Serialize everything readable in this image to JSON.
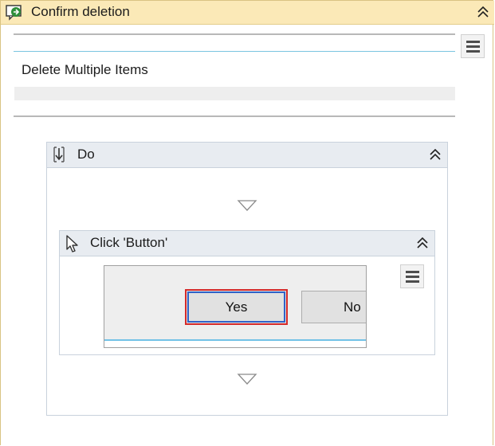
{
  "activity": {
    "title": "Confirm deletion",
    "icon": "message-box-icon",
    "collapse_icon": "chevron-double-up-icon",
    "menu_icon": "hamburger-menu-icon"
  },
  "message_text": "Delete Multiple Items",
  "do_sequence": {
    "title": "Do",
    "icon": "sequence-icon",
    "collapse_icon": "chevron-double-up-icon",
    "drop_icon": "drop-arrow-icon"
  },
  "click_activity": {
    "title": "Click 'Button'",
    "icon": "pointer-cursor-icon",
    "collapse_icon": "chevron-double-up-icon",
    "menu_icon": "hamburger-menu-icon",
    "preview": {
      "yes_label": "Yes",
      "no_label": "No"
    }
  },
  "colors": {
    "title_bar": "#fbe9b7",
    "highlight_red": "#d52a2a",
    "highlight_blue": "#2f62c8",
    "separator_blue": "#79c4e0"
  }
}
